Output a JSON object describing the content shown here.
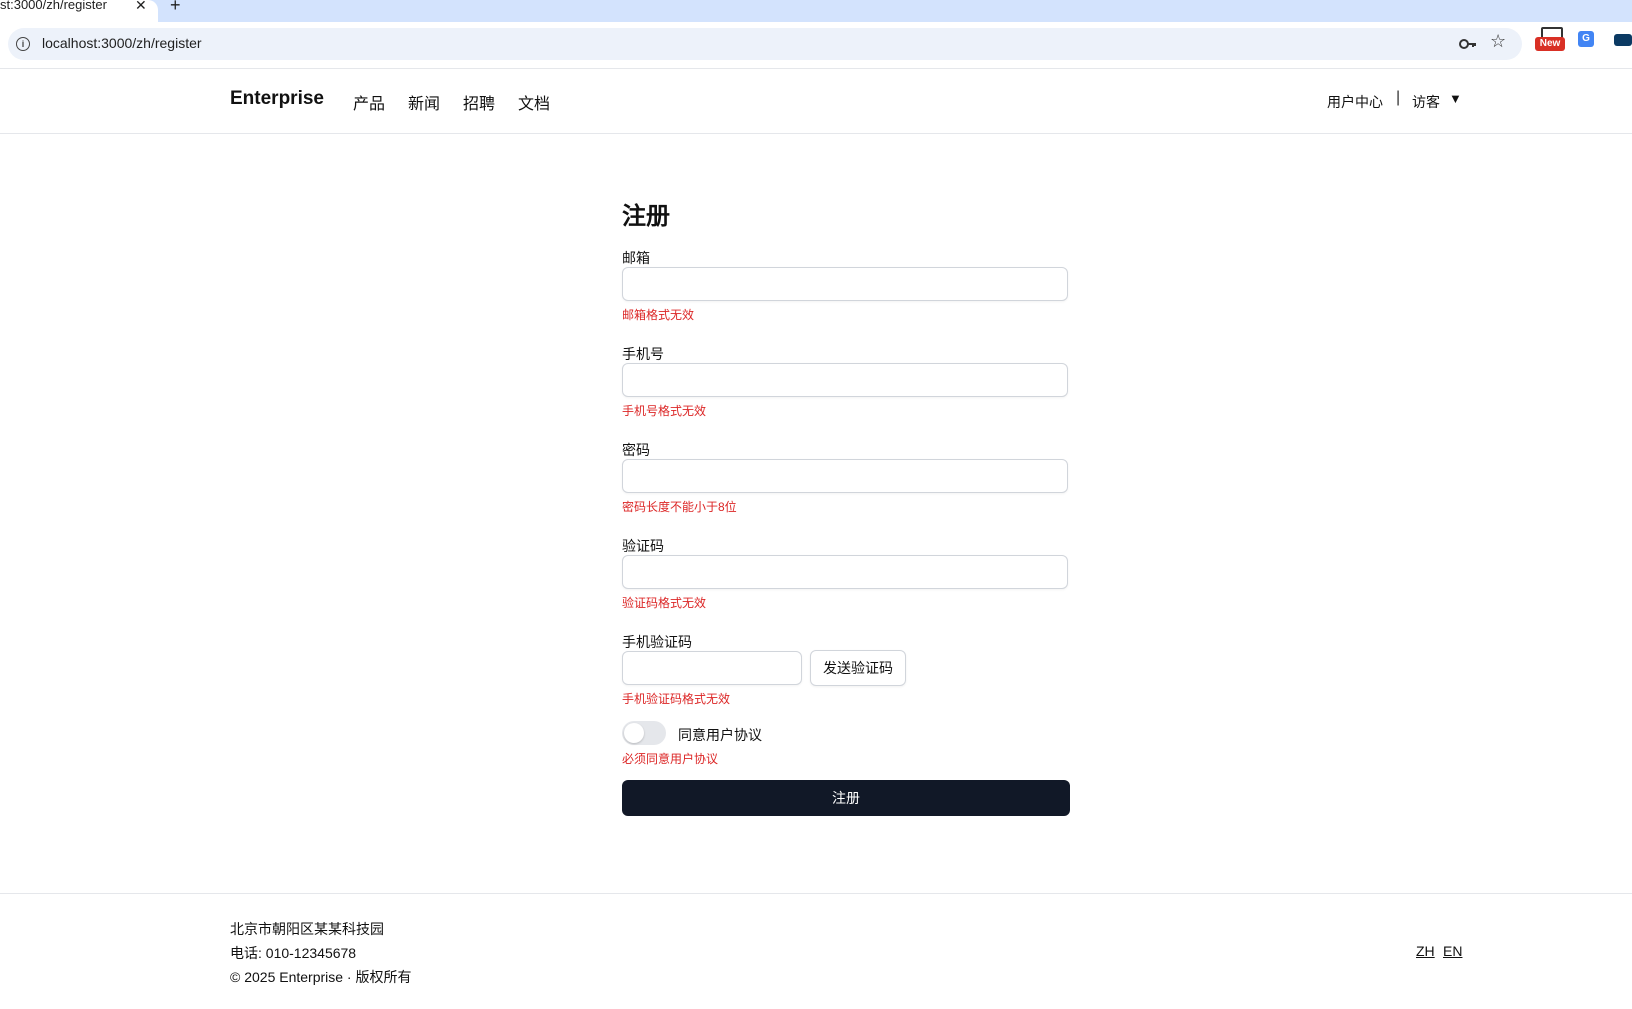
{
  "browser": {
    "tab_title": "st:3000/zh/register",
    "tab_close": "✕",
    "new_tab": "+",
    "url": "localhost:3000/zh/register",
    "extension_badge": "New"
  },
  "header": {
    "brand": "Enterprise",
    "nav": [
      "产品",
      "新闻",
      "招聘",
      "文档"
    ],
    "user_center": "用户中心",
    "separator": "|",
    "visitor": "访客",
    "caret": "▼"
  },
  "form": {
    "title": "注册",
    "email": {
      "label": "邮箱",
      "value": "",
      "error": "邮箱格式无效"
    },
    "phone": {
      "label": "手机号",
      "value": "",
      "error": "手机号格式无效"
    },
    "password": {
      "label": "密码",
      "value": "",
      "error": "密码长度不能小于8位"
    },
    "captcha": {
      "label": "验证码",
      "value": "",
      "error": "验证码格式无效"
    },
    "sms_code": {
      "label": "手机验证码",
      "value": "",
      "send_button": "发送验证码",
      "error": "手机验证码格式无效"
    },
    "agreement": {
      "label": "同意用户协议",
      "checked": false,
      "error": "必须同意用户协议"
    },
    "submit": "注册"
  },
  "footer": {
    "address": "北京市朝阳区某某科技园",
    "phone": "电话: 010-12345678",
    "copyright": "© 2025 Enterprise · 版权所有",
    "lang_zh": "ZH",
    "lang_en": "EN"
  },
  "colors": {
    "error": "#dc2626",
    "primary_button": "#111827",
    "tabstrip": "#d3e3fd",
    "omnibox": "#edf2fa"
  }
}
